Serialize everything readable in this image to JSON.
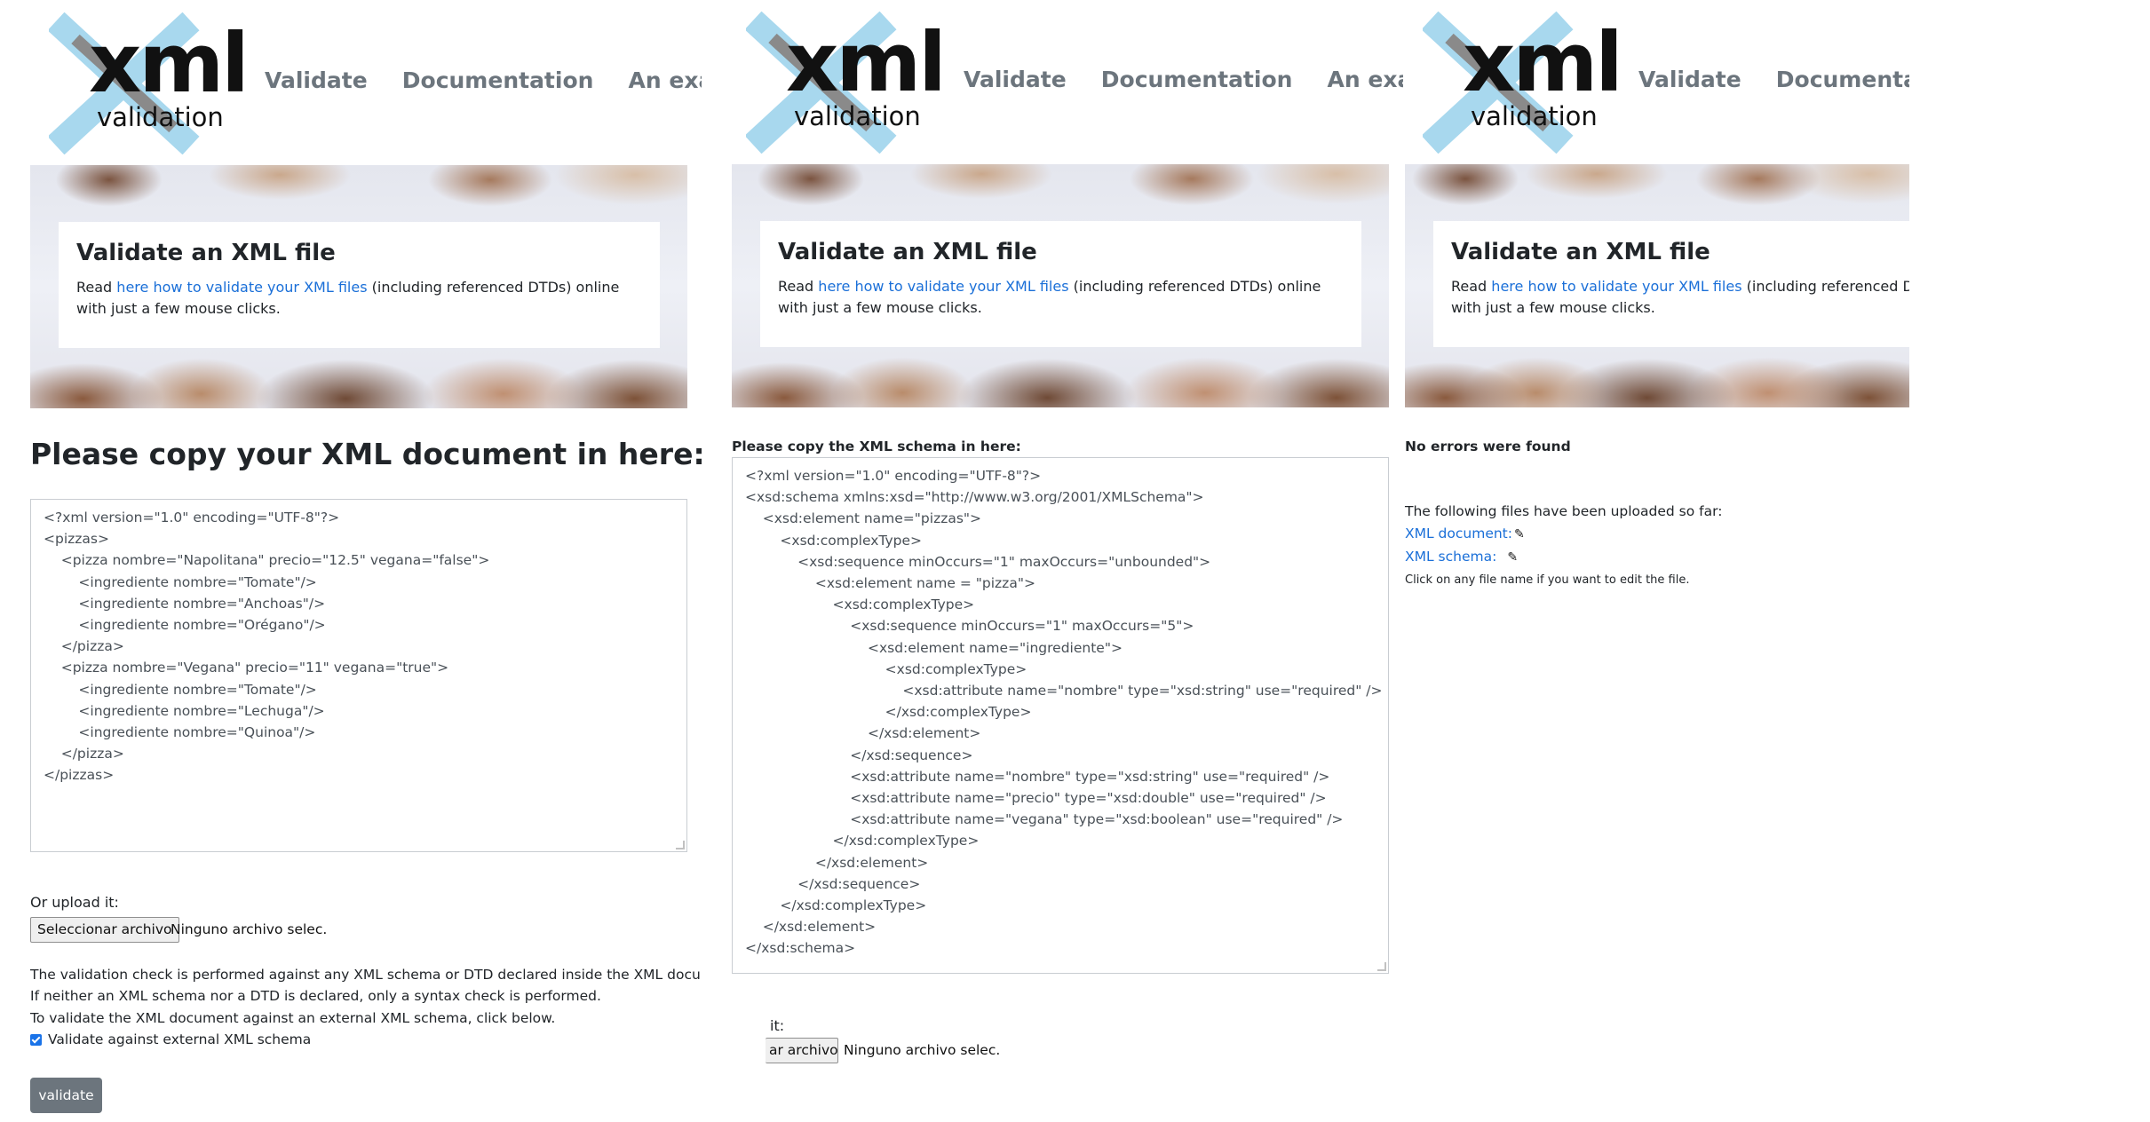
{
  "logo": {
    "word": "xml",
    "sub": "validation"
  },
  "nav": [
    "Validate",
    "Documentation",
    "An example"
  ],
  "hero": {
    "title": "Validate an XML file",
    "text_before": "Read ",
    "link": "here how to validate your XML files",
    "text_after": " (including referenced DTDs) online with just a few mouse clicks."
  },
  "panel1": {
    "heading": "Please copy your XML document in here:",
    "xml_document": "<?xml version=\"1.0\" encoding=\"UTF-8\"?>\n<pizzas>\n    <pizza nombre=\"Napolitana\" precio=\"12.5\" vegana=\"false\">\n        <ingrediente nombre=\"Tomate\"/>\n        <ingrediente nombre=\"Anchoas\"/>\n        <ingrediente nombre=\"Orégano\"/>\n    </pizza>\n    <pizza nombre=\"Vegana\" precio=\"11\" vegana=\"true\">\n        <ingrediente nombre=\"Tomate\"/>\n        <ingrediente nombre=\"Lechuga\"/>\n        <ingrediente nombre=\"Quinoa\"/>\n    </pizza>\n</pizzas>",
    "upload_label": "Or upload it:",
    "file_button": "Seleccionar archivo",
    "file_none": "Ninguno archivo selec.",
    "info_lines": [
      "The validation check is performed against any XML schema or DTD declared inside the XML document.",
      "If neither an XML schema nor a DTD is declared, only a syntax check is performed.",
      "To validate the XML document against an external XML schema, click below."
    ],
    "checkbox_label": "Validate against external XML schema",
    "checkbox_checked": true,
    "validate_button": "validate"
  },
  "panel2": {
    "heading": "Please copy the XML schema in here:",
    "xml_schema": "<?xml version=\"1.0\" encoding=\"UTF-8\"?>\n<xsd:schema xmlns:xsd=\"http://www.w3.org/2001/XMLSchema\">\n    <xsd:element name=\"pizzas\">\n        <xsd:complexType>\n            <xsd:sequence minOccurs=\"1\" maxOccurs=\"unbounded\">\n                <xsd:element name = \"pizza\">\n                    <xsd:complexType>\n                        <xsd:sequence minOccurs=\"1\" maxOccurs=\"5\">\n                            <xsd:element name=\"ingrediente\">\n                                <xsd:complexType>\n                                    <xsd:attribute name=\"nombre\" type=\"xsd:string\" use=\"required\" />\n                                </xsd:complexType>\n                            </xsd:element>\n                        </xsd:sequence>\n                        <xsd:attribute name=\"nombre\" type=\"xsd:string\" use=\"required\" />\n                        <xsd:attribute name=\"precio\" type=\"xsd:double\" use=\"required\" />\n                        <xsd:attribute name=\"vegana\" type=\"xsd:boolean\" use=\"required\" />\n                    </xsd:complexType>\n                </xsd:element>\n            </xsd:sequence>\n        </xsd:complexType>\n    </xsd:element>\n</xsd:schema>",
    "upload_label": "it:",
    "file_button": "ar archivo",
    "file_none": "Ninguno archivo selec."
  },
  "panel3": {
    "result": "No errors were found",
    "uploaded_heading": "The following files have been uploaded so far:",
    "file1": "XML document:",
    "file2": "XML schema:",
    "hint": "Click on any file name if you want to edit the file."
  },
  "colors": {
    "link": "#1a6fd8",
    "button": "#6c757d",
    "logo_x": "#a8d8ee",
    "nav": "#6c757d"
  }
}
